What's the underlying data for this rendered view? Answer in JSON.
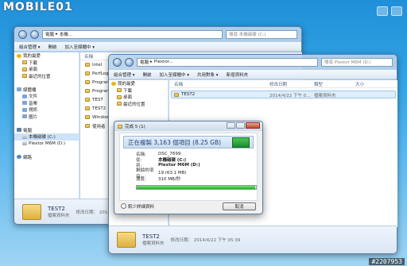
{
  "site_logo": "MOBILE01",
  "watermark": "#2207953",
  "back_window": {
    "address": [
      "電腦",
      "本機...",
      "▸"
    ],
    "search_placeholder": "搜尋 本機磁碟 (C:)",
    "toolbar": [
      "組合管理 ▾",
      "開啟",
      "加入至媒櫃中 ▾"
    ],
    "nav": [
      {
        "label": "我的最愛",
        "icon": "star",
        "sub": false
      },
      {
        "label": "下載",
        "icon": "folder",
        "sub": true
      },
      {
        "label": "桌面",
        "icon": "folder",
        "sub": true
      },
      {
        "label": "最近的位置",
        "icon": "folder",
        "sub": true
      },
      {
        "label": "",
        "icon": "",
        "sub": false
      },
      {
        "label": "媒體櫃",
        "icon": "lib",
        "sub": false
      },
      {
        "label": "文件",
        "icon": "lib",
        "sub": true
      },
      {
        "label": "音樂",
        "icon": "lib",
        "sub": true
      },
      {
        "label": "視訊",
        "icon": "lib",
        "sub": true
      },
      {
        "label": "圖片",
        "icon": "lib",
        "sub": true
      },
      {
        "label": "",
        "icon": "",
        "sub": false
      },
      {
        "label": "電腦",
        "icon": "pc",
        "sub": false
      },
      {
        "label": "本機磁碟 (C:)",
        "icon": "drive",
        "sub": true,
        "selected": true
      },
      {
        "label": "Plextor M6M (D:)",
        "icon": "drive",
        "sub": true
      },
      {
        "label": "",
        "icon": "",
        "sub": false
      },
      {
        "label": "網路",
        "icon": "net",
        "sub": false
      }
    ],
    "col_name": "名稱",
    "files": [
      "Intel",
      "PerfLogs",
      "Program",
      "Program",
      "TEST",
      "TEST2",
      "Windows",
      "使用者"
    ],
    "details": {
      "name": "TEST2",
      "type": "檔案資料夾",
      "modified_label": "修改日期：",
      "modified": "2014/4/22 下午 0..."
    }
  },
  "front_window": {
    "address": [
      "電腦",
      "Plextor...",
      "▸"
    ],
    "search_placeholder": "搜尋 Plextor M6M (D:)",
    "toolbar": [
      "組合管理 ▾",
      "開啟",
      "加入至媒櫃中 ▾",
      "共用對象 ▾",
      "新增資料夾"
    ],
    "nav": [
      {
        "label": "我的最愛",
        "icon": "star",
        "sub": false
      },
      {
        "label": "下載",
        "icon": "folder",
        "sub": true
      },
      {
        "label": "桌面",
        "icon": "folder",
        "sub": true
      },
      {
        "label": "最近的位置",
        "icon": "folder",
        "sub": true
      }
    ],
    "columns": {
      "name": "名稱",
      "date": "修改日期",
      "type": "類型",
      "size": "大小"
    },
    "row": {
      "name": "TEST2",
      "date": "2014/4/22 下午 0...",
      "type": "檔案資料夾"
    },
    "details": {
      "name": "TEST2",
      "type": "檔案資料夾",
      "modified_label": "修改日期：",
      "modified": "2014/4/22 下午 05:39"
    }
  },
  "copy_dialog": {
    "title": "完成 5 (1)",
    "heading": "正在複製 3,163 個項目 (8.25 GB)",
    "name_k": "名稱:",
    "name_v": "DSC_7699",
    "from_k": "從:",
    "from_v": "本機磁碟 (C:)",
    "to_k": "到:",
    "to_v": "Plextor M6M (D:)",
    "remain_k": "剩餘的項目:",
    "remain_v": "19 (63.1 MB)",
    "speed_k": "速度:",
    "speed_v": "310 MB/秒",
    "progress": 0.99,
    "less_detail": "較少詳細資料",
    "cancel": "取消"
  }
}
